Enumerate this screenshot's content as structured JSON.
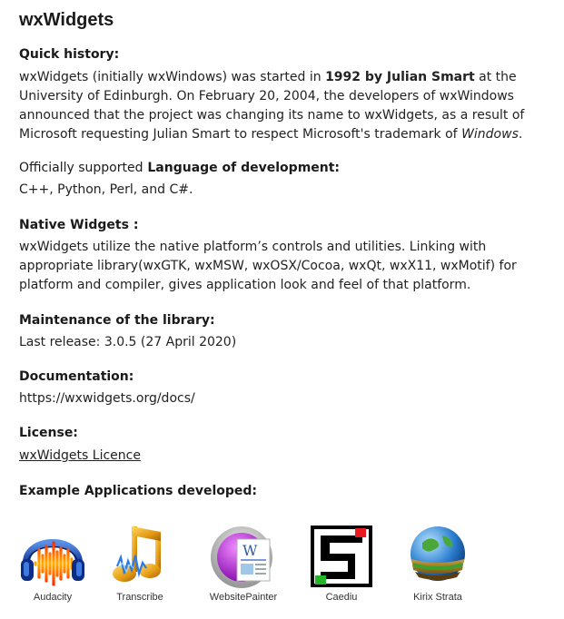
{
  "title": "wxWidgets",
  "history": {
    "heading": "Quick history:",
    "t1": "wxWidgets (initially wxWindows) was started in ",
    "bold": "1992 by Julian Smart",
    "t2": " at the University of Edinburgh. On February 20, 2004, the developers of wxWindows announced that the project was changing its name to wxWidgets, as a result of Microsoft requesting Julian Smart to respect Microsoft's trademark of ",
    "italic": "Windows",
    "t3": "."
  },
  "language": {
    "heading_a": "Officially supported",
    "heading_b": " Language of development:",
    "value": "C++, Python, Perl, and C#."
  },
  "native": {
    "heading": "Native Widgets :",
    "text": "wxWidgets utilize the native platform’s controls and utilities. Linking with appropriate library(wxGTK, wxMSW, wxOSX/Cocoa, wxQt, wxX11, wxMotif) for platform and compiler, gives application look and feel of that platform."
  },
  "maintenance": {
    "heading": "Maintenance of the library:",
    "text": "Last release: 3.0.5 (27 April 2020)"
  },
  "documentation": {
    "heading": "Documentation:",
    "text": "https://wxwidgets.org/docs/"
  },
  "license": {
    "heading": "License:",
    "link": "wxWidgets Licence"
  },
  "examples": {
    "heading": "Example Applications developed:",
    "apps": [
      {
        "label": "Audacity",
        "icon": "audacity-icon"
      },
      {
        "label": "Transcribe",
        "icon": "transcribe-icon"
      },
      {
        "label": "WebsitePainter",
        "icon": "websitepainter-icon"
      },
      {
        "label": "Caediu",
        "icon": "caediu-icon"
      },
      {
        "label": "Kirix Strata",
        "icon": "kirix-strata-icon"
      }
    ]
  }
}
